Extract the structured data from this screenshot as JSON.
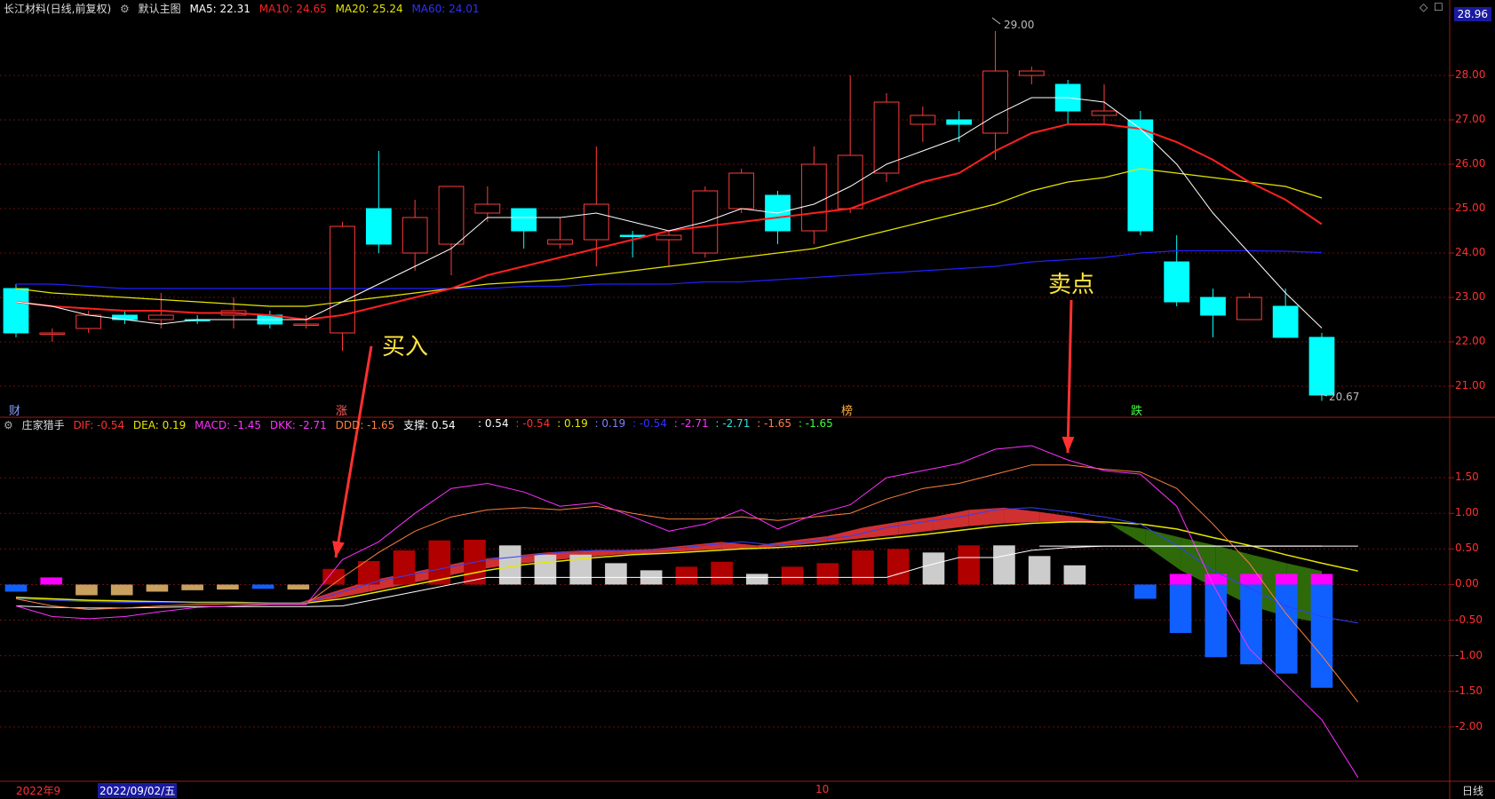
{
  "main_header": {
    "stock": "长江材料(日线,前复权)",
    "mode": "默认主图",
    "ma5": "MA5: 22.31",
    "ma10": "MA10: 24.65",
    "ma20": "MA20: 25.24",
    "ma60": "MA60: 24.01"
  },
  "price_axis": [
    "28.00",
    "27.00",
    "26.00",
    "25.00",
    "24.00",
    "23.00",
    "22.00",
    "21.00"
  ],
  "current_price": "28.96",
  "high_label": "29.00",
  "low_label": "20.67",
  "event_tags": [
    "财",
    "涨",
    "榜",
    "跌"
  ],
  "annotations": {
    "buy": "买入",
    "sell": "卖点"
  },
  "sub_header": {
    "name": "庄家猎手",
    "dif": "DIF: -0.54",
    "dea": "DEA: 0.19",
    "macd": "MACD: -1.45",
    "dkk": "DKK: -2.71",
    "ddd": "DDD: -1.65",
    "support": "支撑: 0.54",
    "extra": [
      ": 0.54",
      ": -0.54",
      ": 0.19",
      ": 0.19",
      ": -0.54",
      ": -2.71",
      ": -2.71",
      ": -1.65",
      ": -1.65"
    ]
  },
  "sub_axis": [
    "1.50",
    "1.00",
    "0.50",
    "0.00",
    "-0.50",
    "-1.00",
    "-1.50",
    "-2.00"
  ],
  "footer": {
    "year": "2022年9",
    "date": "2022/09/02/五",
    "month": "10",
    "period": "日线"
  },
  "colors": {
    "up": "#ff3b3b",
    "down": "#00ffff",
    "ma5": "#ffffff",
    "ma10": "#ff2020",
    "ma20": "#e6e600",
    "ma60": "#2020ff"
  },
  "chart_data": {
    "type": "candlestick",
    "ylim": [
      20.5,
      29.3
    ],
    "candles": [
      [
        23.2,
        22.2,
        23.3,
        22.1,
        "d"
      ],
      [
        22.2,
        22.2,
        22.3,
        22.0,
        "u"
      ],
      [
        22.3,
        22.6,
        22.7,
        22.2,
        "u"
      ],
      [
        22.6,
        22.5,
        22.7,
        22.4,
        "d"
      ],
      [
        22.5,
        22.6,
        23.1,
        22.3,
        "u"
      ],
      [
        22.5,
        22.5,
        22.6,
        22.4,
        "d"
      ],
      [
        22.6,
        22.7,
        23.0,
        22.3,
        "u"
      ],
      [
        22.6,
        22.4,
        22.7,
        22.3,
        "d"
      ],
      [
        22.4,
        22.4,
        22.6,
        22.3,
        "u"
      ],
      [
        22.2,
        24.6,
        24.7,
        21.8,
        "u"
      ],
      [
        25.0,
        24.2,
        26.3,
        24.0,
        "d"
      ],
      [
        24.0,
        24.8,
        25.2,
        23.6,
        "u"
      ],
      [
        24.2,
        25.5,
        25.5,
        23.5,
        "u"
      ],
      [
        24.9,
        25.1,
        25.5,
        24.7,
        "u"
      ],
      [
        25.0,
        24.5,
        25.0,
        24.1,
        "d"
      ],
      [
        24.2,
        24.3,
        24.8,
        24.1,
        "u"
      ],
      [
        24.3,
        25.1,
        26.4,
        23.7,
        "u"
      ],
      [
        24.4,
        24.4,
        24.5,
        23.9,
        "d"
      ],
      [
        24.3,
        24.4,
        24.5,
        23.7,
        "u"
      ],
      [
        24.0,
        25.4,
        25.5,
        23.9,
        "u"
      ],
      [
        25.0,
        25.8,
        25.9,
        24.9,
        "u"
      ],
      [
        25.3,
        24.5,
        25.4,
        24.2,
        "d"
      ],
      [
        24.5,
        26.0,
        26.4,
        24.2,
        "u"
      ],
      [
        25.0,
        26.2,
        28.0,
        24.9,
        "u"
      ],
      [
        25.8,
        27.4,
        27.6,
        25.6,
        "u"
      ],
      [
        26.9,
        27.1,
        27.3,
        26.5,
        "u"
      ],
      [
        27.0,
        26.9,
        27.2,
        26.5,
        "d"
      ],
      [
        26.7,
        28.1,
        29.0,
        26.1,
        "u"
      ],
      [
        28.0,
        28.1,
        28.2,
        27.8,
        "u"
      ],
      [
        27.8,
        27.2,
        27.9,
        26.9,
        "d"
      ],
      [
        27.1,
        27.2,
        27.8,
        26.9,
        "u"
      ],
      [
        27.0,
        24.5,
        27.2,
        24.4,
        "d"
      ],
      [
        23.8,
        22.9,
        24.4,
        22.8,
        "d"
      ],
      [
        23.0,
        22.6,
        23.2,
        22.1,
        "d"
      ],
      [
        22.5,
        23.0,
        23.1,
        22.5,
        "u"
      ],
      [
        22.8,
        22.1,
        23.2,
        22.1,
        "d"
      ],
      [
        22.1,
        20.8,
        22.2,
        20.67,
        "d"
      ]
    ],
    "ma5": [
      22.9,
      22.8,
      22.6,
      22.5,
      22.4,
      22.5,
      22.5,
      22.5,
      22.5,
      22.9,
      23.3,
      23.7,
      24.1,
      24.8,
      24.8,
      24.8,
      24.9,
      24.7,
      24.5,
      24.7,
      25.0,
      24.9,
      25.1,
      25.5,
      26.0,
      26.3,
      26.6,
      27.1,
      27.5,
      27.5,
      27.4,
      26.8,
      26.0,
      24.9,
      24.0,
      23.1,
      22.31
    ],
    "ma10": [
      22.9,
      22.8,
      22.75,
      22.7,
      22.7,
      22.65,
      22.65,
      22.6,
      22.5,
      22.6,
      22.8,
      23.0,
      23.2,
      23.5,
      23.7,
      23.9,
      24.1,
      24.3,
      24.5,
      24.6,
      24.7,
      24.8,
      24.9,
      25.0,
      25.3,
      25.6,
      25.8,
      26.3,
      26.7,
      26.9,
      26.9,
      26.8,
      26.5,
      26.1,
      25.6,
      25.2,
      24.65
    ],
    "ma20": [
      23.2,
      23.1,
      23.05,
      23.0,
      22.95,
      22.9,
      22.85,
      22.8,
      22.8,
      22.9,
      23.0,
      23.1,
      23.2,
      23.3,
      23.35,
      23.4,
      23.5,
      23.6,
      23.7,
      23.8,
      23.9,
      24.0,
      24.1,
      24.3,
      24.5,
      24.7,
      24.9,
      25.1,
      25.4,
      25.6,
      25.7,
      25.9,
      25.8,
      25.7,
      25.6,
      25.5,
      25.24
    ],
    "ma60": [
      23.3,
      23.3,
      23.25,
      23.2,
      23.2,
      23.2,
      23.2,
      23.2,
      23.2,
      23.2,
      23.2,
      23.2,
      23.2,
      23.2,
      23.25,
      23.25,
      23.3,
      23.3,
      23.3,
      23.35,
      23.35,
      23.4,
      23.45,
      23.5,
      23.55,
      23.6,
      23.65,
      23.7,
      23.8,
      23.85,
      23.9,
      24.0,
      24.05,
      24.05,
      24.05,
      24.04,
      24.01
    ]
  },
  "indicator_data": {
    "ylim": [
      -2.7,
      2.1
    ],
    "bars": [
      -0.1,
      0.1,
      -0.15,
      -0.15,
      -0.1,
      -0.08,
      -0.07,
      -0.06,
      -0.07,
      0.22,
      0.33,
      0.48,
      0.62,
      0.63,
      0.55,
      0.42,
      0.42,
      0.3,
      0.2,
      0.25,
      0.32,
      0.15,
      0.25,
      0.3,
      0.48,
      0.5,
      0.45,
      0.55,
      0.55,
      0.4,
      0.27,
      0.0,
      -0.2,
      -0.68,
      -1.02,
      -1.12,
      -1.25,
      -1.45
    ],
    "bar_kind": [
      "b",
      "m",
      "g",
      "g",
      "g",
      "g",
      "g",
      "b",
      "g",
      "r",
      "r",
      "r",
      "r",
      "r",
      "w",
      "w",
      "w",
      "w",
      "w",
      "r",
      "r",
      "w",
      "r",
      "r",
      "r",
      "r",
      "w",
      "r",
      "w",
      "w",
      "w",
      "x",
      "b",
      "b",
      "b",
      "b",
      "b",
      "b"
    ],
    "dif": [
      -0.2,
      -0.22,
      -0.24,
      -0.25,
      -0.25,
      -0.26,
      -0.26,
      -0.26,
      -0.26,
      -0.1,
      0.05,
      0.15,
      0.25,
      0.35,
      0.4,
      0.45,
      0.48,
      0.48,
      0.5,
      0.55,
      0.6,
      0.55,
      0.62,
      0.68,
      0.8,
      0.88,
      0.95,
      1.05,
      1.08,
      1.02,
      0.95,
      0.85,
      0.55,
      0.2,
      -0.05,
      -0.3,
      -0.45,
      -0.54
    ],
    "dea": [
      -0.18,
      -0.2,
      -0.22,
      -0.23,
      -0.24,
      -0.25,
      -0.25,
      -0.26,
      -0.26,
      -0.2,
      -0.1,
      0.0,
      0.1,
      0.2,
      0.28,
      0.33,
      0.38,
      0.42,
      0.44,
      0.47,
      0.5,
      0.52,
      0.55,
      0.6,
      0.65,
      0.7,
      0.76,
      0.82,
      0.86,
      0.88,
      0.88,
      0.85,
      0.78,
      0.66,
      0.55,
      0.42,
      0.3,
      0.19
    ],
    "dkk": [
      -0.3,
      -0.45,
      -0.48,
      -0.45,
      -0.38,
      -0.32,
      -0.3,
      -0.28,
      -0.28,
      0.35,
      0.6,
      1.0,
      1.35,
      1.42,
      1.3,
      1.1,
      1.15,
      0.95,
      0.75,
      0.85,
      1.05,
      0.78,
      0.98,
      1.12,
      1.5,
      1.6,
      1.7,
      1.9,
      1.95,
      1.75,
      1.6,
      1.55,
      1.1,
      0.0,
      -0.9,
      -1.4,
      -1.9,
      -2.71
    ],
    "ddd": [
      -0.2,
      -0.3,
      -0.35,
      -0.33,
      -0.3,
      -0.28,
      -0.27,
      -0.27,
      -0.27,
      0.1,
      0.45,
      0.75,
      0.95,
      1.05,
      1.08,
      1.05,
      1.1,
      1.0,
      0.92,
      0.92,
      0.95,
      0.9,
      0.95,
      1.0,
      1.2,
      1.35,
      1.42,
      1.55,
      1.68,
      1.68,
      1.62,
      1.58,
      1.35,
      0.85,
      0.3,
      -0.4,
      -1.0,
      -1.65
    ],
    "support": [
      -0.3,
      -0.32,
      -0.33,
      -0.33,
      -0.32,
      -0.31,
      -0.31,
      -0.31,
      -0.31,
      -0.3,
      -0.2,
      -0.1,
      0.0,
      0.1,
      0.1,
      0.1,
      0.1,
      0.1,
      0.1,
      0.1,
      0.1,
      0.1,
      0.1,
      0.1,
      0.1,
      0.25,
      0.38,
      0.38,
      0.48,
      0.52,
      0.54,
      0.54,
      0.54,
      0.54,
      0.54,
      0.54,
      0.54,
      0.54
    ]
  }
}
